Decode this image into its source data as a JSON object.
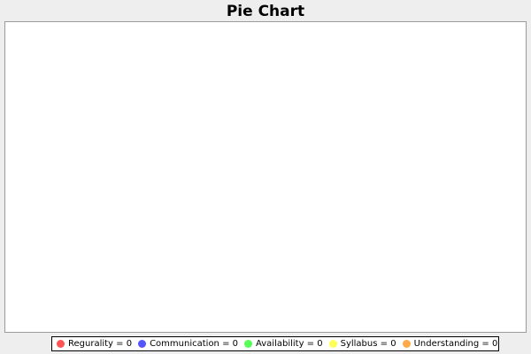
{
  "chart_data": {
    "type": "pie",
    "title": "Pie Chart",
    "categories": [
      "Regurality",
      "Communication",
      "Availability",
      "Syllabus",
      "Understanding"
    ],
    "values": [
      0,
      0,
      0,
      0,
      0
    ],
    "legend_placement": "bottom",
    "legend": [
      {
        "label": "Regurality = 0",
        "color": "#ff5555"
      },
      {
        "label": "Communication = 0",
        "color": "#5555ff"
      },
      {
        "label": "Availability = 0",
        "color": "#55ff55"
      },
      {
        "label": "Syllabus = 0",
        "color": "#ffff55"
      },
      {
        "label": "Understanding = 0",
        "color": "#ffaa44"
      }
    ],
    "colors": [
      "#ff5555",
      "#5555ff",
      "#55ff55",
      "#ffff55",
      "#ffaa44"
    ]
  }
}
